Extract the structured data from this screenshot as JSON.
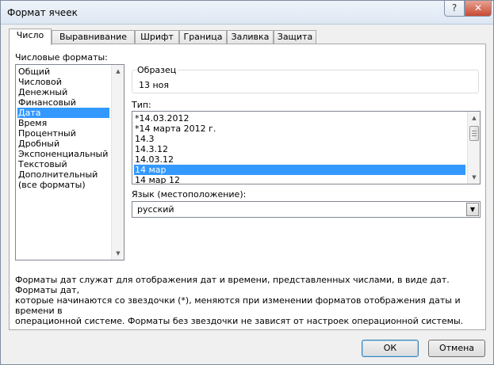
{
  "window": {
    "title": "Формат ячеек",
    "help_glyph": "?",
    "close_glyph": "✕"
  },
  "tabs": [
    {
      "label": "Число",
      "active": true
    },
    {
      "label": "Выравнивание"
    },
    {
      "label": "Шрифт"
    },
    {
      "label": "Граница"
    },
    {
      "label": "Заливка"
    },
    {
      "label": "Защита"
    }
  ],
  "categories": {
    "label": "Числовые форматы:",
    "items": [
      "Общий",
      "Числовой",
      "Денежный",
      "Финансовый",
      "Дата",
      "Время",
      "Процентный",
      "Дробный",
      "Экспоненциальный",
      "Текстовый",
      "Дополнительный",
      "(все форматы)"
    ],
    "selected": "Дата"
  },
  "sample": {
    "label": "Образец",
    "value": "13 ноя"
  },
  "type": {
    "label": "Тип:",
    "items": [
      "*14.03.2012",
      "*14 марта 2012 г.",
      "14.3",
      "14.3.12",
      "14.03.12",
      "14 мар",
      "14 мар 12"
    ],
    "selected": "14 мар"
  },
  "locale": {
    "label": "Язык (местоположение):",
    "value": "русский"
  },
  "description": {
    "line1": "Форматы дат служат для отображения дат и времени, представленных числами, в виде дат. Форматы дат,",
    "line2": "которые начинаются со звездочки (*), меняются при изменении форматов отображения даты и времени в",
    "line3": "операционной системе. Форматы без звездочки не зависят от настроек операционной системы."
  },
  "buttons": {
    "ok": "ОК",
    "cancel": "Отмена"
  },
  "colors": {
    "selection": "#3399ff",
    "close_button": "#c74a33"
  }
}
